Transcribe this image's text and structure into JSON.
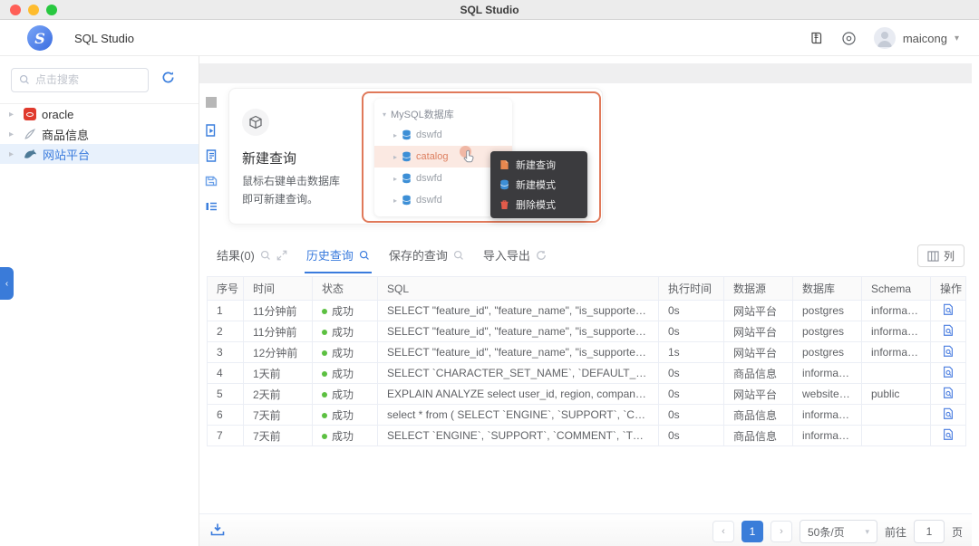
{
  "colors": {
    "accent": "#3a7bdd",
    "success": "#5cc041",
    "highlight_border": "#e0795a",
    "oracle_red": "#e03a2d"
  },
  "titlebar": {
    "title": "SQL Studio"
  },
  "header": {
    "app_name": "SQL Studio",
    "user": {
      "name": "maicong"
    }
  },
  "sidebar": {
    "search": {
      "placeholder": "点击搜索"
    },
    "tree": [
      {
        "label": "oracle"
      },
      {
        "label": "商品信息"
      },
      {
        "label": "网站平台"
      }
    ]
  },
  "onboarding": {
    "title": "新建查询",
    "desc_line1": "鼠标右键单击数据库",
    "desc_line2": "即可新建查询。",
    "illustration": {
      "root_label": "MySQL数据库",
      "items": [
        {
          "label": "dswfd"
        },
        {
          "label": "catalog"
        },
        {
          "label": "dswfd"
        },
        {
          "label": "dswfd"
        }
      ],
      "menu": [
        {
          "label": "新建查询"
        },
        {
          "label": "新建模式"
        },
        {
          "label": "删除模式"
        }
      ]
    }
  },
  "tabs": {
    "results": "结果(0)",
    "history": "历史查询",
    "saved": "保存的查询",
    "import_export": "导入导出"
  },
  "columns_button": {
    "label": "列"
  },
  "table": {
    "headers": [
      "序号",
      "时间",
      "状态",
      "SQL",
      "执行时间",
      "数据源",
      "数据库",
      "Schema",
      "操作"
    ],
    "rows": [
      {
        "no": "1",
        "time": "11分钟前",
        "status": "成功",
        "sql": "SELECT \"feature_id\", \"feature_name\", \"is_supported\", \"is_verified_...",
        "exec": "0s",
        "source": "网站平台",
        "db": "postgres",
        "schema": "information..."
      },
      {
        "no": "2",
        "time": "11分钟前",
        "status": "成功",
        "sql": "SELECT \"feature_id\", \"feature_name\", \"is_supported\", \"is_verified_...",
        "exec": "0s",
        "source": "网站平台",
        "db": "postgres",
        "schema": "information..."
      },
      {
        "no": "3",
        "time": "12分钟前",
        "status": "成功",
        "sql": "SELECT \"feature_id\", \"feature_name\", \"is_supported\", \"is_verified_...",
        "exec": "1s",
        "source": "网站平台",
        "db": "postgres",
        "schema": "information..."
      },
      {
        "no": "4",
        "time": "1天前",
        "status": "成功",
        "sql": "SELECT `CHARACTER_SET_NAME`, `DEFAULT_COLLATE_NAME`...",
        "exec": "0s",
        "source": "商品信息",
        "db": "information...",
        "schema": ""
      },
      {
        "no": "5",
        "time": "2天前",
        "status": "成功",
        "sql": "EXPLAIN ANALYZE select user_id, region, company_name, positio...",
        "exec": "0s",
        "source": "网站平台",
        "db": "websiteTest",
        "schema": "public"
      },
      {
        "no": "6",
        "time": "7天前",
        "status": "成功",
        "sql": "select * from ( SELECT `ENGINE`, `SUPPORT`, `COMMENT`, `TRA...",
        "exec": "0s",
        "source": "商品信息",
        "db": "information...",
        "schema": ""
      },
      {
        "no": "7",
        "time": "7天前",
        "status": "成功",
        "sql": "SELECT `ENGINE`, `SUPPORT`, `COMMENT`, `TRANSACTIONS`, `...",
        "exec": "0s",
        "source": "商品信息",
        "db": "information...",
        "schema": ""
      }
    ]
  },
  "footer": {
    "current_page": "1",
    "page_size": "50条/页",
    "goto_label": "前往",
    "goto_value": "1",
    "page_unit": "页"
  }
}
